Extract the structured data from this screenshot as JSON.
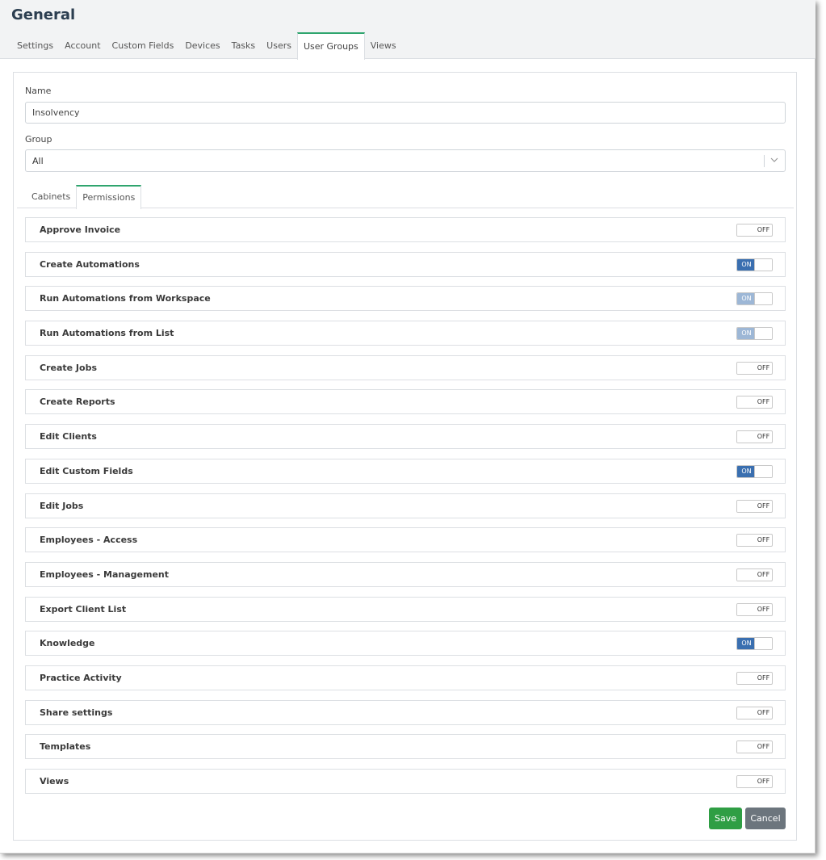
{
  "page": {
    "title": "General"
  },
  "top_tabs": [
    {
      "label": "Settings",
      "active": false
    },
    {
      "label": "Account",
      "active": false
    },
    {
      "label": "Custom Fields",
      "active": false
    },
    {
      "label": "Devices",
      "active": false
    },
    {
      "label": "Tasks",
      "active": false
    },
    {
      "label": "Users",
      "active": false
    },
    {
      "label": "User Groups",
      "active": true
    },
    {
      "label": "Views",
      "active": false
    }
  ],
  "form": {
    "name_label": "Name",
    "name_value": "Insolvency",
    "group_label": "Group",
    "group_value": "All"
  },
  "inner_tabs": [
    {
      "label": "Cabinets",
      "active": false
    },
    {
      "label": "Permissions",
      "active": true
    }
  ],
  "permissions": [
    {
      "label": "Approve Invoice",
      "state": "OFF",
      "disabled": false
    },
    {
      "label": "Create Automations",
      "state": "ON",
      "disabled": false
    },
    {
      "label": "Run Automations from Workspace",
      "state": "ON",
      "disabled": true
    },
    {
      "label": "Run Automations from List",
      "state": "ON",
      "disabled": true
    },
    {
      "label": "Create Jobs",
      "state": "OFF",
      "disabled": false
    },
    {
      "label": "Create Reports",
      "state": "OFF",
      "disabled": false
    },
    {
      "label": "Edit Clients",
      "state": "OFF",
      "disabled": false
    },
    {
      "label": "Edit Custom Fields",
      "state": "ON",
      "disabled": false
    },
    {
      "label": "Edit Jobs",
      "state": "OFF",
      "disabled": false
    },
    {
      "label": "Employees - Access",
      "state": "OFF",
      "disabled": false
    },
    {
      "label": "Employees - Management",
      "state": "OFF",
      "disabled": false
    },
    {
      "label": "Export Client List",
      "state": "OFF",
      "disabled": false
    },
    {
      "label": "Knowledge",
      "state": "ON",
      "disabled": false
    },
    {
      "label": "Practice Activity",
      "state": "OFF",
      "disabled": false
    },
    {
      "label": "Share settings",
      "state": "OFF",
      "disabled": false
    },
    {
      "label": "Templates",
      "state": "OFF",
      "disabled": false
    },
    {
      "label": "Views",
      "state": "OFF",
      "disabled": false
    }
  ],
  "buttons": {
    "save": "Save",
    "cancel": "Cancel"
  },
  "colors": {
    "toggle_on": "#3a6fb0",
    "toggle_on_disabled": "#9db7d6",
    "active_tab_border": "#2fa56e",
    "save": "#2f9e44",
    "cancel": "#6c757d"
  },
  "icons": {
    "select_arrow": "chevron-down-icon"
  }
}
